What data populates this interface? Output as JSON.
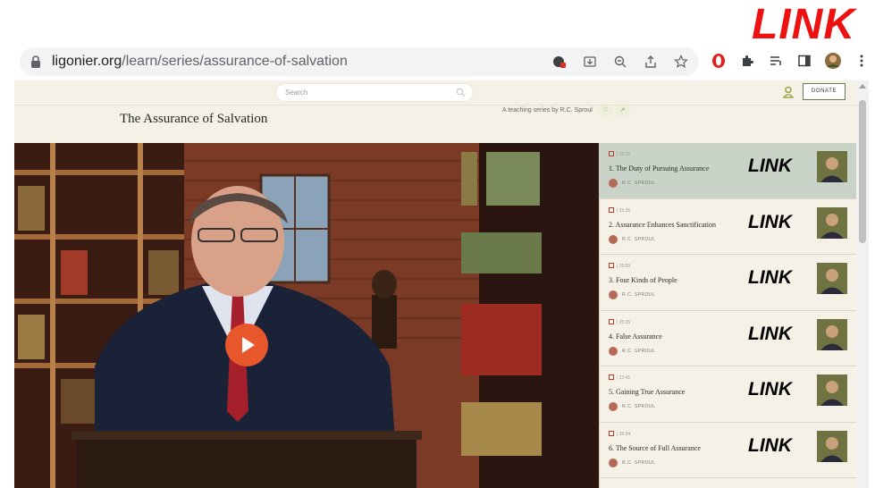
{
  "overlay": {
    "top_link": "LINK"
  },
  "browser": {
    "url_domain": "ligonier.org",
    "url_path": "/learn/series/assurance-of-salvation",
    "icons": [
      "site-info-icon",
      "install-icon",
      "zoom-icon",
      "share-icon",
      "bookmark-star-icon"
    ],
    "extensions": [
      "opera-extension-icon",
      "extensions-puzzle-icon",
      "reading-list-icon",
      "side-panel-icon",
      "profile-icon",
      "menu-icon"
    ]
  },
  "site": {
    "search_placeholder": "Search",
    "donate_label": "DONATE",
    "series_title": "The Assurance of Salvation",
    "teaching_by": "A teaching series by R.C. Sproul"
  },
  "player": {
    "play_icon": "play-icon"
  },
  "playlist": {
    "items": [
      {
        "duration": "22:22",
        "title": "1. The Duty of Pursuing Assurance",
        "author": "R.C. SPROUL",
        "overlay": "LINK",
        "active": true
      },
      {
        "duration": "25:35",
        "title": "2. Assurance Enhances Sanctification",
        "author": "R.C. SPROUL",
        "overlay": "LINK",
        "active": false
      },
      {
        "duration": "25:59",
        "title": "3. Four Kinds of People",
        "author": "R.C. SPROUL",
        "overlay": "LINK",
        "active": false
      },
      {
        "duration": "25:35",
        "title": "4. False Assurance",
        "author": "R.C. SPROUL",
        "overlay": "LINK",
        "active": false
      },
      {
        "duration": "22:41",
        "title": "5. Gaining True Assurance",
        "author": "R.C. SPROUL",
        "overlay": "LINK",
        "active": false
      },
      {
        "duration": "25:04",
        "title": "6. The Source of Full Assurance",
        "author": "R.C. SPROUL",
        "overlay": "LINK",
        "active": false
      }
    ]
  },
  "colors": {
    "accent": "#e8562b",
    "overlay_red": "#ee1111",
    "active_row": "#c9d3c8",
    "background": "#f6f1e6"
  }
}
